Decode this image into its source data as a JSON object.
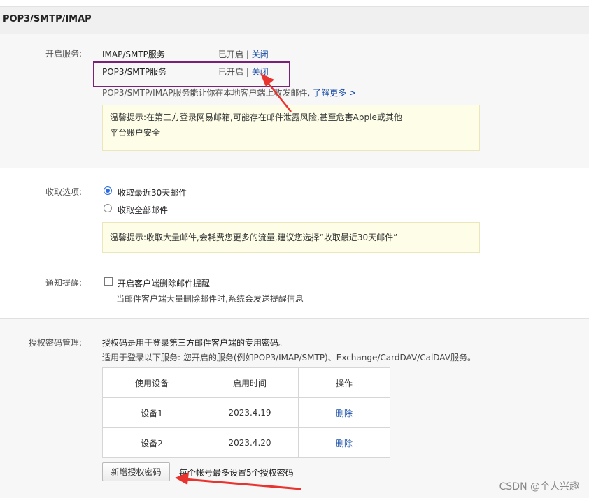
{
  "header": {
    "title": "POP3/SMTP/IMAP"
  },
  "services": {
    "label": "开启服务:",
    "items": [
      {
        "name": "IMAP/SMTP服务",
        "status": "已开启",
        "separator": "|",
        "action": "关闭"
      },
      {
        "name": "POP3/SMTP服务",
        "status": "已开启",
        "separator": "|",
        "action": "关闭"
      }
    ],
    "description": "POP3/SMTP/IMAP服务能让你在本地客户端上收发邮件,",
    "learn_more": "了解更多 >",
    "tip_line1": "温馨提示:在第三方登录网易邮箱,可能存在邮件泄露风险,甚至危害Apple或其他",
    "tip_line2": "平台账户安全"
  },
  "receive": {
    "label": "收取选项:",
    "options": [
      {
        "text": "收取最近30天邮件",
        "selected": true
      },
      {
        "text": "收取全部邮件",
        "selected": false
      }
    ],
    "tip": "温馨提示:收取大量邮件,会耗费您更多的流量,建议您选择“收取最近30天邮件”"
  },
  "notify": {
    "label": "通知提醒:",
    "checkbox_text": "开启客户端删除邮件提醒",
    "checked": false,
    "description": "当邮件客户端大量删除邮件时,系统会发送提醒信息"
  },
  "auth": {
    "label": "授权密码管理:",
    "line1": "授权码是用于登录第三方邮件客户端的专用密码。",
    "line2": "适用于登录以下服务: 您开启的服务(例如POP3/IMAP/SMTP)、Exchange/CardDAV/CalDAV服务。",
    "columns": [
      "使用设备",
      "启用时间",
      "操作"
    ],
    "rows": [
      {
        "device": "设备1",
        "date": "2023.4.19",
        "action": "删除"
      },
      {
        "device": "设备2",
        "date": "2023.4.20",
        "action": "删除"
      }
    ],
    "add_button": "新增授权密码",
    "limit_note": "每个帐号最多设置5个授权密码"
  },
  "watermark": "CSDN @个人兴趣",
  "colors": {
    "link": "#1b4fa8",
    "highlight": "#7a1f7a",
    "arrow": "#e8332f",
    "tip_bg": "#fdfde8"
  }
}
